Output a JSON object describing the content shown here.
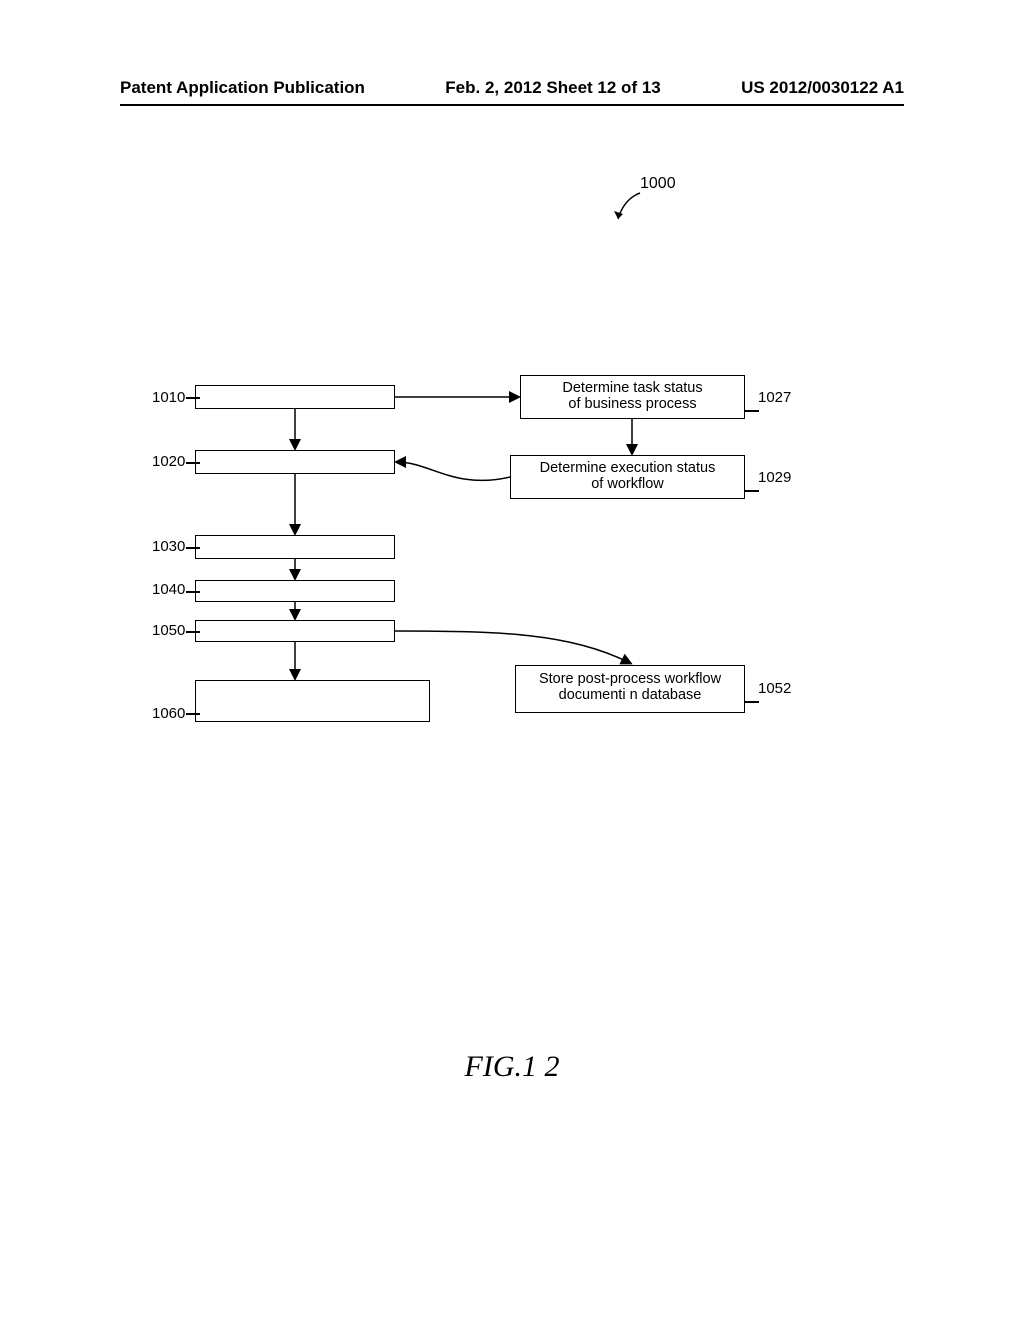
{
  "header": {
    "left": "Patent Application Publication",
    "center": "Feb. 2, 2012  Sheet 12 of 13",
    "right": "US 2012/0030122 A1"
  },
  "refs": {
    "r1000": "1000",
    "r1010": "1010",
    "r1020": "1020",
    "r1030": "1030",
    "r1040": "1040",
    "r1050": "1050",
    "r1060": "1060",
    "r1027": "1027",
    "r1029": "1029",
    "r1052": "1052"
  },
  "boxes": {
    "b1027_l1": "Determine task status",
    "b1027_l2": "of business process",
    "b1029_l1": "Determine execution status",
    "b1029_l2": "of workflow",
    "b1052_l1": "Store post-process workflow",
    "b1052_l2": "documenti n database"
  },
  "figure_label": "FIG.1 2",
  "chart_data": {
    "type": "flowchart",
    "title": "FIG. 12 — method 1000",
    "entry_ref": "1000",
    "nodes": [
      {
        "id": "1010",
        "label": ""
      },
      {
        "id": "1020",
        "label": ""
      },
      {
        "id": "1030",
        "label": ""
      },
      {
        "id": "1040",
        "label": ""
      },
      {
        "id": "1050",
        "label": ""
      },
      {
        "id": "1060",
        "label": ""
      },
      {
        "id": "1027",
        "label": "Determine task status of business process"
      },
      {
        "id": "1029",
        "label": "Determine execution status of workflow"
      },
      {
        "id": "1052",
        "label": "Store post-process workflow document in database"
      }
    ],
    "edges": [
      {
        "from": "1010",
        "to": "1020"
      },
      {
        "from": "1010",
        "to": "1027"
      },
      {
        "from": "1027",
        "to": "1029"
      },
      {
        "from": "1029",
        "to": "1020"
      },
      {
        "from": "1020",
        "to": "1030"
      },
      {
        "from": "1030",
        "to": "1040"
      },
      {
        "from": "1040",
        "to": "1050"
      },
      {
        "from": "1050",
        "to": "1060"
      },
      {
        "from": "1050",
        "to": "1052"
      }
    ]
  }
}
